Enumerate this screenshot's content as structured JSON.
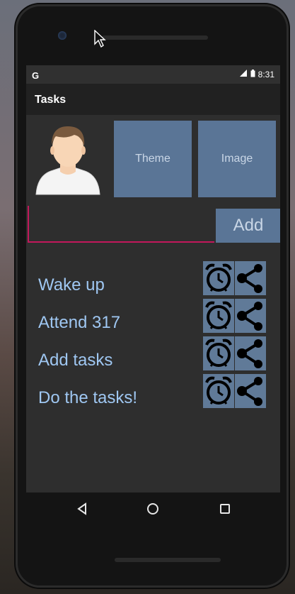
{
  "status_bar": {
    "carrier_glyph": "G",
    "time": "8:31"
  },
  "app_bar": {
    "title": "Tasks"
  },
  "profile": {
    "theme_label": "Theme",
    "image_label": "Image"
  },
  "composer": {
    "input_value": "",
    "add_label": "Add"
  },
  "tasks": [
    {
      "label": "Wake up"
    },
    {
      "label": "Attend 317"
    },
    {
      "label": "Add tasks"
    },
    {
      "label": "Do the tasks!"
    }
  ],
  "colors": {
    "accent": "#5a7596",
    "task_text": "#9fc7f2",
    "input_underline": "#c2185b"
  },
  "icons": [
    "alarm-clock-icon",
    "share-icon",
    "back-icon",
    "home-icon",
    "recents-icon"
  ]
}
